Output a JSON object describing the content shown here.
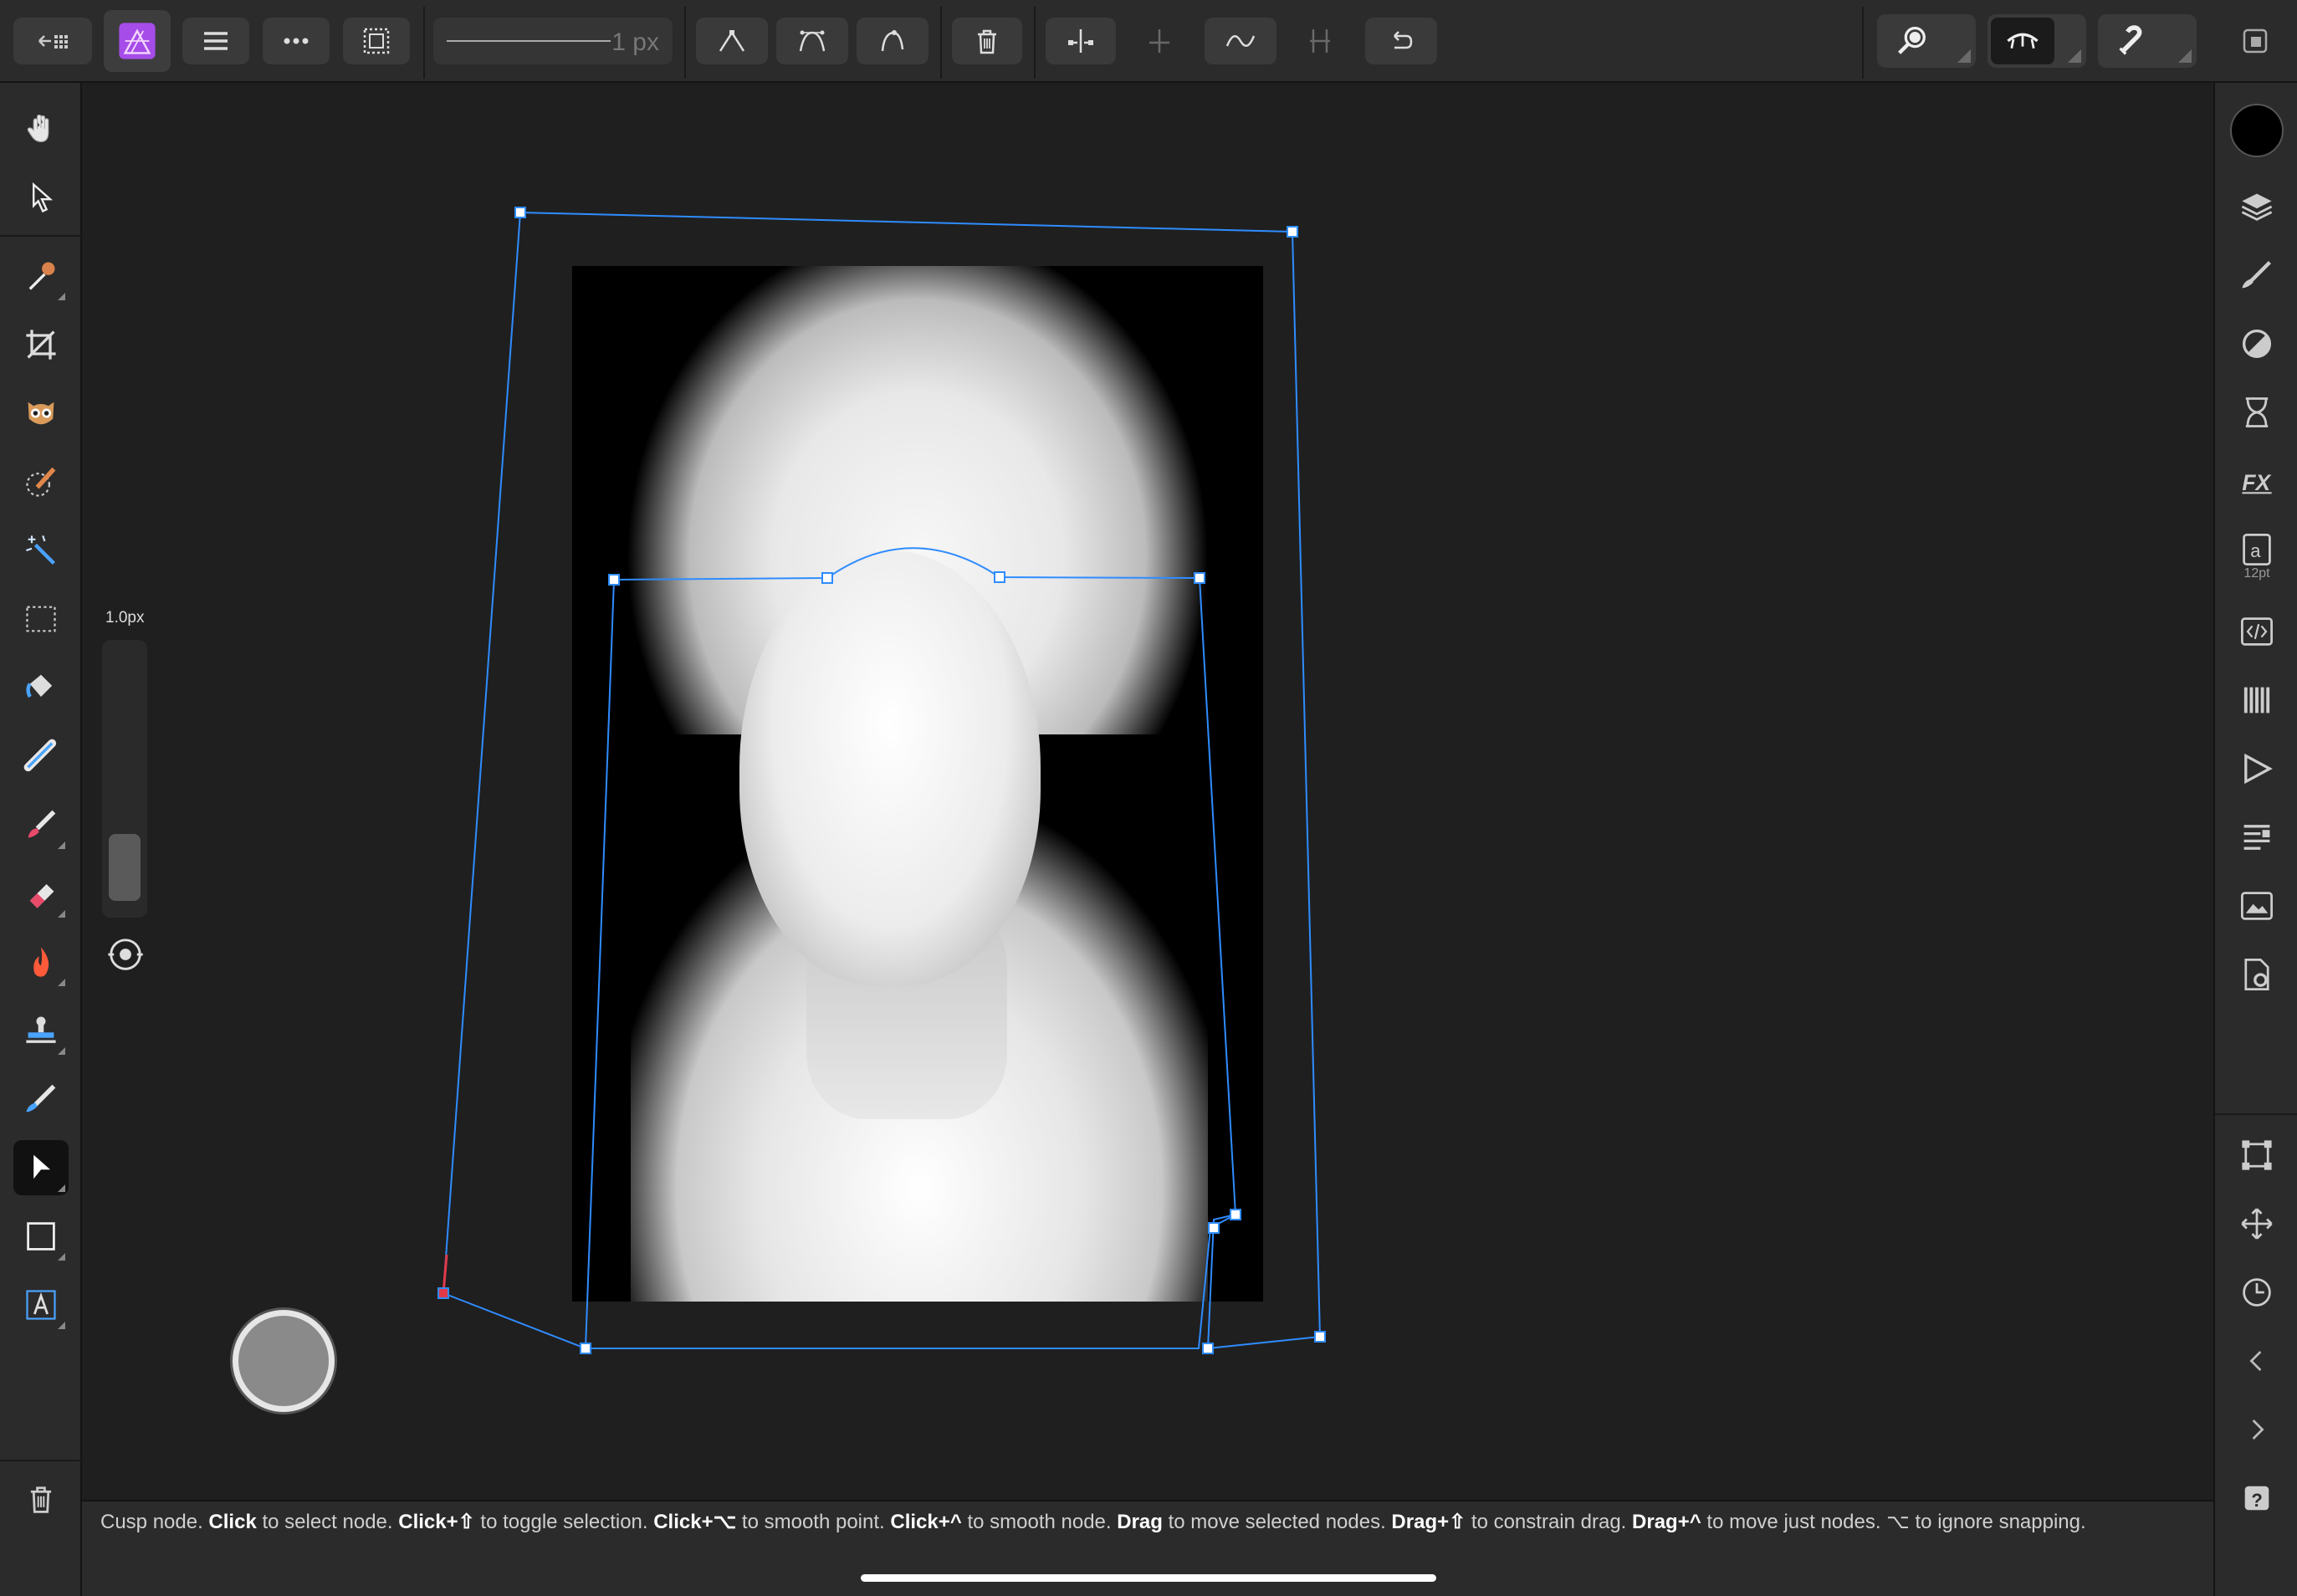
{
  "top_toolbar": {
    "stroke_width_label": "1 px",
    "buttons": [
      {
        "name": "back-to-documents-button",
        "icon": "back-grid-icon"
      },
      {
        "name": "app-logo-button",
        "icon": "affinity-photo-icon"
      },
      {
        "name": "main-menu-button",
        "icon": "hamburger-icon"
      },
      {
        "name": "more-button",
        "icon": "ellipsis-icon"
      },
      {
        "name": "selection-button",
        "icon": "marquee-icon"
      },
      {
        "name": "convert-to-sharp-button",
        "icon": "sharp-node-icon"
      },
      {
        "name": "convert-to-smooth-button",
        "icon": "smooth-node-icon"
      },
      {
        "name": "convert-to-smart-button",
        "icon": "smart-node-icon"
      },
      {
        "name": "delete-node-button",
        "icon": "trash-icon"
      },
      {
        "name": "break-curve-button",
        "icon": "break-icon"
      },
      {
        "name": "join-curves-button",
        "icon": "join-icon"
      },
      {
        "name": "smooth-curve-button",
        "icon": "curve-icon"
      },
      {
        "name": "close-curve-button",
        "icon": "close-curve-icon"
      },
      {
        "name": "reverse-curve-button",
        "icon": "reverse-icon"
      },
      {
        "name": "zoom-view-button",
        "icon": "magnifier-icon"
      },
      {
        "name": "view-mode-button",
        "icon": "eye-icon"
      },
      {
        "name": "snapping-button",
        "icon": "magnet-icon"
      },
      {
        "name": "window-button",
        "icon": "window-icon"
      }
    ]
  },
  "left_tools": [
    {
      "name": "view-tool",
      "icon": "hand-icon"
    },
    {
      "name": "move-tool",
      "icon": "arrow-cursor-icon"
    },
    {
      "name": "color-picker-tool",
      "icon": "eyedropper-icon"
    },
    {
      "name": "crop-tool",
      "icon": "crop-icon"
    },
    {
      "name": "selection-brush-tool",
      "icon": "owl-icon"
    },
    {
      "name": "flood-select-tool",
      "icon": "paint-palette-icon"
    },
    {
      "name": "magic-wand-tool",
      "icon": "magic-wand-icon"
    },
    {
      "name": "marquee-tool",
      "icon": "dashed-rect-icon"
    },
    {
      "name": "flood-fill-tool",
      "icon": "bucket-icon"
    },
    {
      "name": "inpainting-tool",
      "icon": "bandage-icon"
    },
    {
      "name": "paint-brush-tool",
      "icon": "brush-icon"
    },
    {
      "name": "erase-tool",
      "icon": "eraser-icon"
    },
    {
      "name": "burn-tool",
      "icon": "flame-icon"
    },
    {
      "name": "clone-tool",
      "icon": "stamp-icon"
    },
    {
      "name": "smudge-tool",
      "icon": "smudge-icon"
    },
    {
      "name": "node-tool",
      "icon": "node-arrow-icon"
    },
    {
      "name": "rectangle-tool",
      "icon": "rectangle-icon"
    },
    {
      "name": "text-tool",
      "icon": "text-frame-icon"
    }
  ],
  "brush_size": {
    "label": "1.0px",
    "level": 0.05
  },
  "right_panel": {
    "font_size_label": "12pt",
    "studios": [
      {
        "name": "layers-studio",
        "icon": "layers-icon"
      },
      {
        "name": "brushes-studio",
        "icon": "brush-studio-icon"
      },
      {
        "name": "adjustments-studio",
        "icon": "adjust-icon"
      },
      {
        "name": "history-studio",
        "icon": "hourglass-icon"
      },
      {
        "name": "effects-studio",
        "icon": "fx-icon"
      },
      {
        "name": "character-studio",
        "icon": "character-icon"
      },
      {
        "name": "macros-studio",
        "icon": "code-icon"
      },
      {
        "name": "channels-studio",
        "icon": "channels-icon"
      },
      {
        "name": "play-studio",
        "icon": "play-icon"
      },
      {
        "name": "stock-studio",
        "icon": "list-icon"
      },
      {
        "name": "navigator-studio",
        "icon": "photo-icon"
      },
      {
        "name": "document-settings-studio",
        "icon": "gear-doc-icon"
      },
      {
        "name": "transform-studio",
        "icon": "transform-icon"
      },
      {
        "name": "move-studio",
        "icon": "move-icon"
      },
      {
        "name": "snapshots-studio",
        "icon": "clock-icon"
      },
      {
        "name": "previous-studio",
        "icon": "chevron-left-icon"
      },
      {
        "name": "next-studio",
        "icon": "chevron-right-icon"
      },
      {
        "name": "help-studio",
        "icon": "help-icon"
      }
    ]
  },
  "status": {
    "parts": [
      {
        "t": "Cusp node. ",
        "b": false
      },
      {
        "t": "Click",
        "b": true
      },
      {
        "t": " to select node. ",
        "b": false
      },
      {
        "t": "Click+⇧",
        "b": true
      },
      {
        "t": " to toggle selection. ",
        "b": false
      },
      {
        "t": "Click+⌥",
        "b": true
      },
      {
        "t": " to smooth point. ",
        "b": false
      },
      {
        "t": "Click+^",
        "b": true
      },
      {
        "t": " to smooth node. ",
        "b": false
      },
      {
        "t": "Drag",
        "b": true
      },
      {
        "t": " to move selected nodes. ",
        "b": false
      },
      {
        "t": "Drag+⇧",
        "b": true
      },
      {
        "t": " to constrain drag. ",
        "b": false
      },
      {
        "t": "Drag+^",
        "b": true
      },
      {
        "t": " to move just nodes. ⌥ to ignore snapping.",
        "b": false
      }
    ]
  },
  "colors": {
    "accent": "#2f8cff",
    "selected_node": "#e03a4a",
    "app_logo": "#a64ce8"
  }
}
